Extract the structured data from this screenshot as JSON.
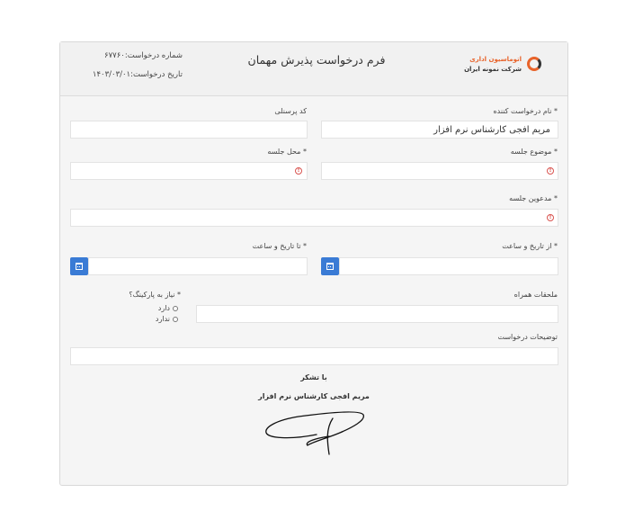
{
  "header": {
    "request_number": "شماره درخواست:۶۷۷۶۰",
    "request_date": "تاریخ درخواست:۱۴۰۳/۰۳/۰۱",
    "title": "فرم درخواست پذیرش مهمان",
    "logo": {
      "line1": "اتوماسیون اداری",
      "line2": "شرکت نمونه ایران",
      "icon": "logo-icon",
      "accent": "#e8632a"
    }
  },
  "form": {
    "requester_label": "نام درخواست کننده *",
    "requester_value": "مریم افجی کارشناس نرم افزار",
    "personnel_code_label": "کد پرسنلی",
    "personnel_code_value": "",
    "meeting_subject_label": "موضوع جلسه *",
    "meeting_location_label": "محل جلسه *",
    "invitees_label": "مدعوین جلسه *",
    "from_datetime_label": "از تاریخ و ساعت *",
    "to_datetime_label": "تا تاریخ و ساعت *",
    "attachments_label": "ملحقات همراه",
    "parking_label": "نیاز به پارکینگ؟ *",
    "parking_options": [
      "دارد",
      "ندارد"
    ],
    "description_label": "توضیحات درخواست"
  },
  "footer": {
    "thanks": "با تشکر",
    "signer": "مریم افجی کارشناس نرم افزار"
  },
  "colors": {
    "error": "#d9534f",
    "calendar_button": "#3a7bd5"
  }
}
